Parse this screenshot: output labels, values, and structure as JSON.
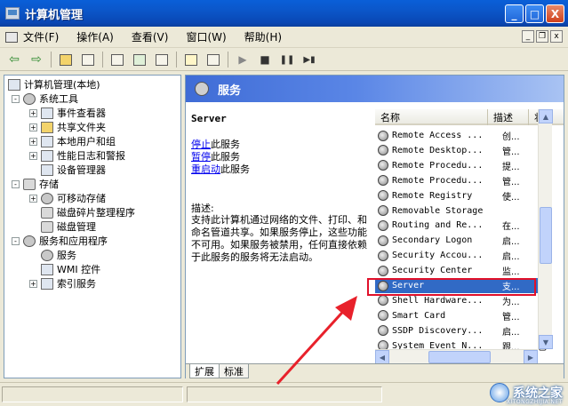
{
  "window": {
    "title": "计算机管理",
    "buttons": {
      "minimize": "_",
      "maximize": "□",
      "close": "X"
    }
  },
  "menu": {
    "items": [
      "文件(F)",
      "操作(A)",
      "查看(V)",
      "窗口(W)",
      "帮助(H)"
    ],
    "mdi": {
      "minimize": "_",
      "restore": "❐",
      "close": "x"
    }
  },
  "toolbar": {
    "buttons": [
      "back-arrow-icon",
      "forward-arrow-icon",
      "up-folder-icon",
      "show-tree-icon",
      "properties-icon",
      "refresh-icon",
      "export-icon",
      "help-icon",
      "console-icon",
      "start-icon",
      "stop-icon",
      "pause-icon",
      "restart-icon"
    ],
    "glyphs": {
      "back": "⇦",
      "forward": "⇨",
      "play": "▶",
      "stop": "■",
      "pause": "❚❚",
      "restart": "▶▮"
    }
  },
  "tree": {
    "root": "计算机管理(本地)",
    "system_tools": "系统工具",
    "event_viewer": "事件查看器",
    "shared_folders": "共享文件夹",
    "local_users": "本地用户和组",
    "perf_logs": "性能日志和警报",
    "device_manager": "设备管理器",
    "storage": "存储",
    "removable_storage": "可移动存储",
    "defrag": "磁盘碎片整理程序",
    "disk_mgmt": "磁盘管理",
    "services_apps": "服务和应用程序",
    "services": "服务",
    "wmi": "WMI 控件",
    "indexing": "索引服务",
    "plus": "+",
    "minus": "-"
  },
  "right_pane": {
    "header": "服务",
    "selected_service": "Server",
    "action_stop_link": "停止",
    "action_stop_text": "此服务",
    "action_pause_link": "暂停",
    "action_pause_text": "此服务",
    "action_restart_link": "重启动",
    "action_restart_text": "此服务",
    "desc_label": "描述:",
    "desc_body": "支持此计算机通过网络的文件、打印、和命名管道共享。如果服务停止，这些功能不可用。如果服务被禁用，任何直接依赖于此服务的服务将无法启动。"
  },
  "services_list": {
    "columns": {
      "name": "名称",
      "desc": "描述",
      "status": "状"
    },
    "rows": [
      {
        "name": "Remote Access ...",
        "desc": "创...",
        "status": "已"
      },
      {
        "name": "Remote Desktop...",
        "desc": "管...",
        "status": ""
      },
      {
        "name": "Remote Procedu...",
        "desc": "提...",
        "status": "已"
      },
      {
        "name": "Remote Procedu...",
        "desc": "管...",
        "status": ""
      },
      {
        "name": "Remote Registry",
        "desc": "使...",
        "status": "已"
      },
      {
        "name": "Removable Storage",
        "desc": "",
        "status": ""
      },
      {
        "name": "Routing and Re...",
        "desc": "在...",
        "status": ""
      },
      {
        "name": "Secondary Logon",
        "desc": "启...",
        "status": "已"
      },
      {
        "name": "Security Accou...",
        "desc": "启...",
        "status": "已"
      },
      {
        "name": "Security Center",
        "desc": "监...",
        "status": "已"
      },
      {
        "name": "Server",
        "desc": "支...",
        "status": "已"
      },
      {
        "name": "Shell Hardware...",
        "desc": "为...",
        "status": "已"
      },
      {
        "name": "Smart Card",
        "desc": "管...",
        "status": ""
      },
      {
        "name": "SSDP Discovery...",
        "desc": "启...",
        "status": "已"
      },
      {
        "name": "System Event N...",
        "desc": "跟...",
        "status": "已"
      }
    ],
    "selected_index": 10
  },
  "tabs": {
    "extended": "扩展",
    "standard": "标准"
  },
  "watermark": {
    "brand": "系统之家",
    "url": "XITONGZHIJIA.NET"
  },
  "colors": {
    "title_bar": "#0a5fd8",
    "header_blue": "#3f6cd6",
    "selection": "#316ac5",
    "highlight_box": "#e0102a"
  }
}
